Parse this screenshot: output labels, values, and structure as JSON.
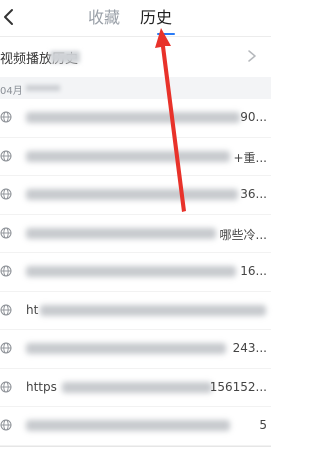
{
  "header": {
    "tabs": [
      {
        "label": "收藏",
        "active": false
      },
      {
        "label": "历史",
        "active": true
      }
    ],
    "accent_color": "#2a7bf6"
  },
  "video_history": {
    "label": "视频播放历史"
  },
  "date_section": {
    "label": "04月"
  },
  "history_items": [
    {
      "lead": "",
      "tail": "90..."
    },
    {
      "lead": "",
      "tail": "+重..."
    },
    {
      "lead": "",
      "tail": "36..."
    },
    {
      "lead": "",
      "tail": "哪些冷..."
    },
    {
      "lead": "",
      "tail": "16..."
    },
    {
      "lead": "ht",
      "tail": ""
    },
    {
      "lead": "",
      "tail": "243..."
    },
    {
      "lead": "https",
      "tail": "156152..."
    },
    {
      "lead": "",
      "tail": "5"
    }
  ],
  "annotation": {
    "arrow_color": "#e8322a"
  }
}
